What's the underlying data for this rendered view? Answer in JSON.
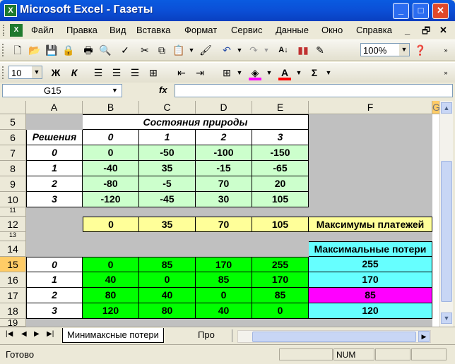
{
  "window": {
    "title": "Microsoft Excel - Газеты",
    "app_icon": "X"
  },
  "window_controls": {
    "minimize": "_",
    "maximize": "□",
    "close": "✕"
  },
  "menu": {
    "items": [
      "Файл",
      "Правка",
      "Вид",
      "Вставка",
      "Формат",
      "Сервис",
      "Данные",
      "Окно",
      "Справка"
    ],
    "window_controls": [
      "_",
      "🗗",
      "✕"
    ]
  },
  "toolbar_standard": {
    "zoom": "100%"
  },
  "toolbar_format": {
    "font_size": "10",
    "bold": "Ж",
    "italic": "К",
    "underline_color": "#ff00ff",
    "fill_color": "#ff00ff",
    "font_color": "#ff0000",
    "sum": "Σ"
  },
  "formula_bar": {
    "name_box": "G15",
    "fx": "fx",
    "formula": ""
  },
  "columns": [
    "A",
    "B",
    "C",
    "D",
    "E",
    "F",
    "G"
  ],
  "rows": [
    {
      "num": "5"
    },
    {
      "num": "6"
    },
    {
      "num": "7"
    },
    {
      "num": "8"
    },
    {
      "num": "9"
    },
    {
      "num": "10"
    },
    {
      "num": "11"
    },
    {
      "num": "12"
    },
    {
      "num": "13"
    },
    {
      "num": "14"
    },
    {
      "num": "15"
    },
    {
      "num": "16"
    },
    {
      "num": "17"
    },
    {
      "num": "18"
    },
    {
      "num": "19"
    }
  ],
  "sheet": {
    "states_header": "Состояния природы",
    "decisions_label": "Решения",
    "state_labels": [
      "0",
      "1",
      "2",
      "3"
    ],
    "payoff_rows": [
      {
        "decision": "0",
        "values": [
          "0",
          "-50",
          "-100",
          "-150"
        ]
      },
      {
        "decision": "1",
        "values": [
          "-40",
          "35",
          "-15",
          "-65"
        ]
      },
      {
        "decision": "2",
        "values": [
          "-80",
          "-5",
          "70",
          "20"
        ]
      },
      {
        "decision": "3",
        "values": [
          "-120",
          "-45",
          "30",
          "105"
        ]
      }
    ],
    "maxima_row": {
      "values": [
        "0",
        "35",
        "70",
        "105"
      ],
      "label": "Максимумы платежей"
    },
    "max_losses_header": "Максимальные потери",
    "loss_rows": [
      {
        "decision": "0",
        "values": [
          "0",
          "85",
          "170",
          "255"
        ],
        "max": "255"
      },
      {
        "decision": "1",
        "values": [
          "40",
          "0",
          "85",
          "170"
        ],
        "max": "170"
      },
      {
        "decision": "2",
        "values": [
          "80",
          "40",
          "0",
          "85"
        ],
        "max": "85"
      },
      {
        "decision": "3",
        "values": [
          "120",
          "80",
          "40",
          "0"
        ],
        "max": "120"
      }
    ],
    "colors": {
      "payoff_bg": "#ccffcc",
      "maxima_bg": "#ffff99",
      "loss_bg": "#00ff00",
      "maxloss_bg": "#66ffff",
      "minimax_bg": "#ff00ff",
      "gray_bg": "#c0c0c0",
      "row15_header_bg": "#ffcc66"
    }
  },
  "tabs": {
    "active": "Минимаксные потери",
    "next": "Про"
  },
  "status": {
    "text": "Готово",
    "num": "NUM"
  }
}
